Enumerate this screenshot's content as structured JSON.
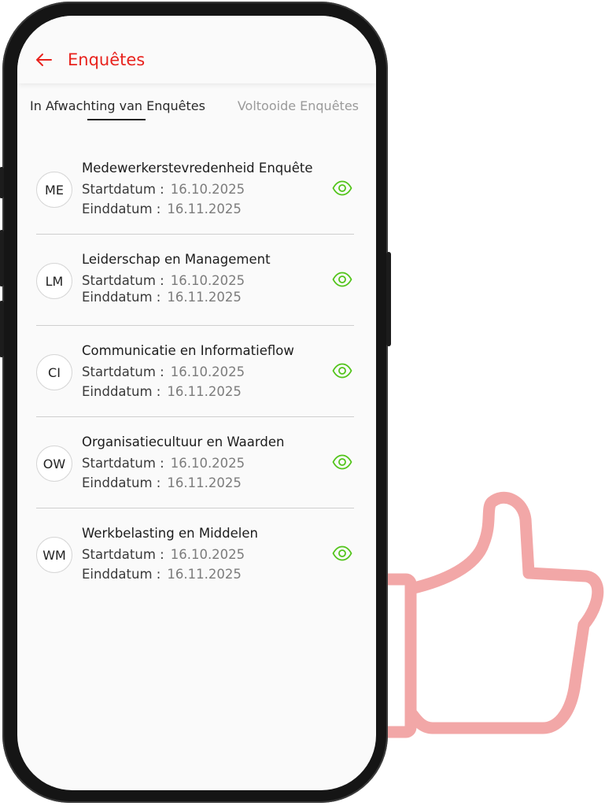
{
  "header": {
    "title": "Enquêtes",
    "accent_color": "#e8231e"
  },
  "tabs": [
    {
      "label": "In Afwachting van Enquêtes",
      "active": true
    },
    {
      "label": "Voltooide Enquêtes",
      "active": false
    }
  ],
  "labels": {
    "start": "Startdatum :",
    "end": "Einddatum :"
  },
  "surveys": [
    {
      "initials": "ME",
      "title": "Medewerkerstevredenheid Enquête",
      "start": "16.10.2025",
      "end": "16.11.2025"
    },
    {
      "initials": "LM",
      "title": "Leiderschap en Management",
      "start": "16.10.2025",
      "end": "16.11.2025"
    },
    {
      "initials": "CI",
      "title": "Communicatie en Informatieflow",
      "start": "16.10.2025",
      "end": "16.11.2025"
    },
    {
      "initials": "OW",
      "title": "Organisatiecultuur en Waarden",
      "start": "16.10.2025",
      "end": "16.11.2025"
    },
    {
      "initials": "WM",
      "title": "Werkbelasting en Middelen",
      "start": "16.10.2025",
      "end": "16.11.2025"
    }
  ],
  "icons": {
    "back": "arrow-left-icon",
    "view": "eye-icon",
    "decoration": "thumbs-up-icon"
  },
  "colors": {
    "view_icon": "#52c41a",
    "thumb": "#f2a7a7"
  }
}
